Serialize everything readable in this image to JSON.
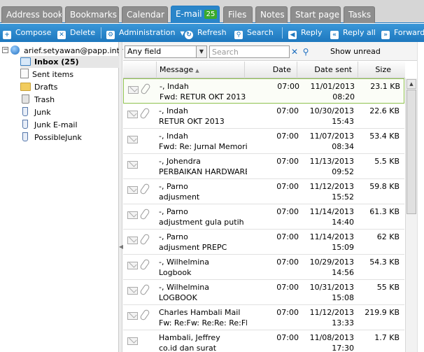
{
  "tabs": [
    {
      "label": "Address book"
    },
    {
      "label": "Bookmarks"
    },
    {
      "label": "Calendar"
    },
    {
      "label": "E-mail",
      "badge": "25",
      "active": true
    },
    {
      "label": "Files"
    },
    {
      "label": "Notes"
    },
    {
      "label": "Start page"
    },
    {
      "label": "Tasks"
    }
  ],
  "toolbar": {
    "compose": "Compose",
    "delete": "Delete",
    "administration": "Administration",
    "refresh": "Refresh",
    "search": "Search",
    "reply": "Reply",
    "reply_all": "Reply all",
    "forward": "Forward"
  },
  "tree": {
    "account": "arief.setyawan@papp.intra",
    "folders": [
      "Inbox (25)",
      "Sent items",
      "Drafts",
      "Trash",
      "Junk",
      "Junk E-mail",
      "PossibleJunk"
    ]
  },
  "filter": {
    "field": "Any field",
    "search_placeholder": "Search",
    "show_unread": "Show unread"
  },
  "columns": {
    "message": "Message",
    "date": "Date",
    "date_sent": "Date sent",
    "size": "Size"
  },
  "messages": [
    {
      "from": "-, Indah",
      "subject": "Fwd: RETUR OKT 2013",
      "date": "07:00",
      "sent_date": "11/01/2013",
      "sent_time": "08:20",
      "size": "23.1 KB",
      "attachment": true
    },
    {
      "from": "-, Indah",
      "subject": "RETUR OKT 2013",
      "date": "07:00",
      "sent_date": "10/30/2013",
      "sent_time": "15:43",
      "size": "22.6 KB",
      "attachment": true
    },
    {
      "from": "-, Indah",
      "subject": "Fwd: Re: Jurnal Memorial",
      "date": "07:00",
      "sent_date": "11/07/2013",
      "sent_time": "08:34",
      "size": "53.4 KB",
      "attachment": false
    },
    {
      "from": "-, Johendra",
      "subject": "PERBAIKAN HARDWARE",
      "date": "07:00",
      "sent_date": "11/13/2013",
      "sent_time": "09:52",
      "size": "5.5 KB",
      "attachment": false
    },
    {
      "from": "-, Parno",
      "subject": "adjusment",
      "date": "07:00",
      "sent_date": "11/12/2013",
      "sent_time": "15:52",
      "size": "59.8 KB",
      "attachment": true
    },
    {
      "from": "-, Parno",
      "subject": "adjustment gula putih",
      "date": "07:00",
      "sent_date": "11/14/2013",
      "sent_time": "14:40",
      "size": "61.3 KB",
      "attachment": true
    },
    {
      "from": "-, Parno",
      "subject": "adjusment PREPC",
      "date": "07:00",
      "sent_date": "11/14/2013",
      "sent_time": "15:09",
      "size": "62 KB",
      "attachment": true
    },
    {
      "from": "-, Wilhelmina",
      "subject": "Logbook",
      "date": "07:00",
      "sent_date": "10/29/2013",
      "sent_time": "14:56",
      "size": "54.3 KB",
      "attachment": true
    },
    {
      "from": "-, Wilhelmina",
      "subject": "LOGBOOK",
      "date": "07:00",
      "sent_date": "10/31/2013",
      "sent_time": "15:08",
      "size": "55 KB",
      "attachment": true
    },
    {
      "from": "Charles Hambali Mail",
      "subject": "Fw: Re:Fw: Re:Re: Re:Fl",
      "date": "07:00",
      "sent_date": "11/12/2013",
      "sent_time": "13:33",
      "size": "219.9 KB",
      "attachment": true
    },
    {
      "from": "Hambali, Jeffrey",
      "subject": "co.id dan surat",
      "date": "07:00",
      "sent_date": "11/08/2013",
      "sent_time": "17:30",
      "size": "1.7 KB",
      "attachment": false
    }
  ]
}
